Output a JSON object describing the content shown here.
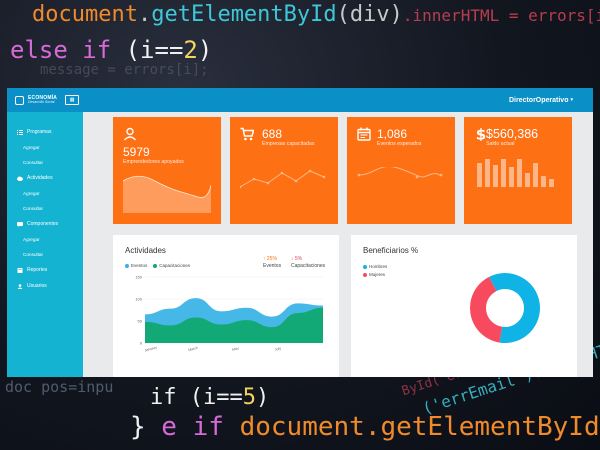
{
  "background_code": {
    "line1_obj": "document",
    "line1_dot": ".",
    "line1_method": "getElementById",
    "line1_args": "(div)",
    "line1_tail": ".innerHTML = errors[i];",
    "line2_kw": "else if",
    "line2_open": " (i==",
    "line2_num": "2",
    "line2_close": ")",
    "line3": "message = errors[i];",
    "line4": "doc pos=inpu",
    "line5_open": "if (i==",
    "line5_num": "5",
    "line5_close": ")",
    "line6_brace": "}",
    "line6_kw": " e if",
    "line6_method": " document.getElementById",
    "line7": "('errEmail').innerHTML",
    "line8": "ById('errEmail')"
  },
  "header": {
    "logo_title": "ECONOMÍA",
    "logo_sub": "Desarrollo Social",
    "user_label": "DirectorOperativo",
    "caret": "▾"
  },
  "sidebar": {
    "sections": [
      {
        "label": "Programas",
        "icon": "list-icon",
        "items": [
          "Agregar",
          "Consultar"
        ]
      },
      {
        "label": "Actividades",
        "icon": "cloud-icon",
        "items": [
          "Agregar",
          "Consultar"
        ]
      },
      {
        "label": "Componentes",
        "icon": "chat-icon",
        "items": [
          "Agregar",
          "Consultar"
        ]
      },
      {
        "label": "Reportes",
        "icon": "book-icon",
        "items": []
      },
      {
        "label": "Usuarios",
        "icon": "users-icon",
        "items": []
      }
    ]
  },
  "cards": [
    {
      "value": "5979",
      "label": "Emprendedores apoyados",
      "icon": "user-icon"
    },
    {
      "value": "688",
      "label": "Empresas capacitadas",
      "icon": "cart-icon"
    },
    {
      "value": "1,086",
      "label": "Eventos esperados",
      "icon": "calendar-icon"
    },
    {
      "value": "$560,386",
      "label": "Saldo actual",
      "icon": "dollar-icon"
    }
  ],
  "colors": {
    "accent": "#fd7014",
    "sidebar": "#13b3d1",
    "topbar": "#0a8fc6",
    "eventos": "#36b2e6",
    "capacitaciones": "#10a870",
    "hombres": "#0fb3e6",
    "mujeres": "#f84a5e"
  },
  "actividades": {
    "title": "Actividades",
    "legend": [
      "Eventos",
      "Capacitaciones"
    ],
    "stat1_value": "↑ 25%",
    "stat1_label": "Eventos",
    "stat2_value": "↓ 5%",
    "stat2_label": "Capacitaciones"
  },
  "beneficiarios": {
    "title": "Beneficiarios %",
    "legend": [
      "Hombres",
      "Mujeres"
    ]
  },
  "chart_data": [
    {
      "type": "area",
      "title": "Actividades",
      "categories": [
        "January",
        "March",
        "May",
        "July"
      ],
      "ylim": [
        0,
        150
      ],
      "yticks": [
        "150",
        "100",
        "50",
        "0"
      ],
      "series": [
        {
          "name": "Eventos",
          "values": [
            65,
            78,
            102,
            72,
            80,
            60,
            90,
            85
          ]
        },
        {
          "name": "Capacitaciones",
          "values": [
            48,
            40,
            58,
            42,
            52,
            36,
            68,
            80
          ]
        }
      ]
    },
    {
      "type": "pie",
      "title": "Beneficiarios %",
      "categories": [
        "Hombres",
        "Mujeres"
      ],
      "values": [
        60,
        40
      ]
    }
  ]
}
